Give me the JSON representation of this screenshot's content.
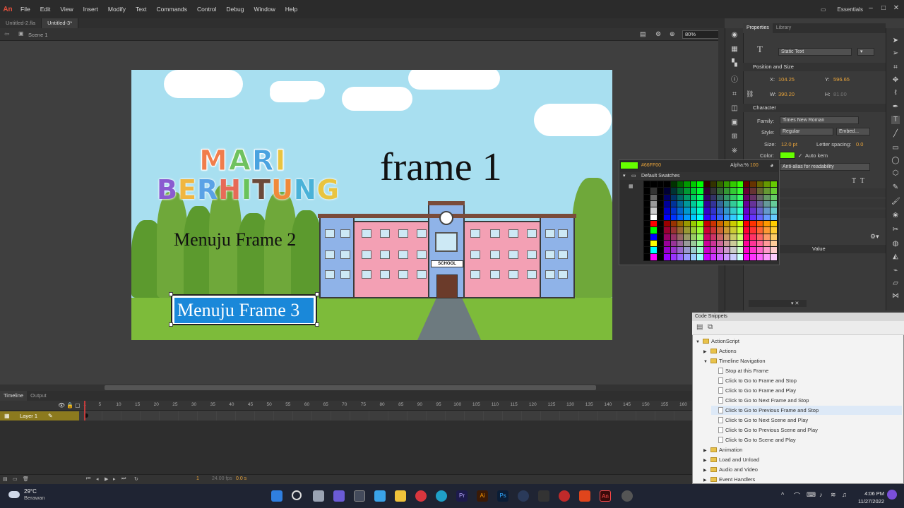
{
  "app": {
    "logo": "An"
  },
  "menu": [
    "File",
    "Edit",
    "View",
    "Insert",
    "Modify",
    "Text",
    "Commands",
    "Control",
    "Debug",
    "Window",
    "Help"
  ],
  "workspace": {
    "label": "Essentials"
  },
  "doc_tabs": [
    "Untitled-2.fla",
    "Untitled-3*"
  ],
  "scene": {
    "label": "Scene 1",
    "zoom": "80%"
  },
  "stage": {
    "title_line1": "MARI",
    "title_line2": "BERHITUNG",
    "frame_text": "frame 1",
    "link2": "Menuju Frame 2",
    "link3": "Menuju Frame 3",
    "school_sign": "SCHOOL",
    "colors": {
      "sky": "#a8dff0",
      "grass": "#7dbb3a",
      "building": "#f3a0b4",
      "wing": "#8fb3e8",
      "selection": "#1a88d9"
    }
  },
  "timeline": {
    "tabs": [
      "Timeline",
      "Output"
    ],
    "ticks": [
      "1",
      "5",
      "10",
      "15",
      "20",
      "25",
      "30",
      "35",
      "40",
      "45",
      "50",
      "55",
      "60",
      "65",
      "70",
      "75",
      "80",
      "85",
      "90",
      "95",
      "100",
      "105",
      "110",
      "115",
      "120",
      "125",
      "130",
      "135",
      "140",
      "145",
      "150",
      "155",
      "160"
    ],
    "layer_name": "Layer 1",
    "current_frame": "1",
    "fps": "24.00 fps",
    "time": "0.0 s"
  },
  "properties": {
    "tabs": [
      "Properties",
      "Library"
    ],
    "text_type": "Static Text",
    "position_section": "Position and Size",
    "x_label": "X:",
    "x": "104.25",
    "y_label": "Y:",
    "y": "596.65",
    "w_label": "W:",
    "w": "390.20",
    "h_label": "H:",
    "h": "81.00",
    "character_section": "Character",
    "family_label": "Family:",
    "family": "Times New Roman",
    "style_label": "Style:",
    "style": "Regular",
    "embed": "Embed...",
    "size_label": "Size:",
    "size": "12.0 pt",
    "spacing_label": "Letter spacing:",
    "spacing": "0.0",
    "color_label": "Color:",
    "text_color": "#66ff00",
    "autokern": "Auto kern",
    "antialias": "Anti-alias for readability",
    "value_header": "Value"
  },
  "swatches": {
    "hex": "#66FF00",
    "alpha_label": "Alpha:%",
    "alpha": "100",
    "title": "Default Swatches"
  },
  "code_snippets": {
    "title": "Code Snippets",
    "items": [
      {
        "label": "ActionScript",
        "kind": "folder",
        "indent": 0,
        "open": true
      },
      {
        "label": "Actions",
        "kind": "folder",
        "indent": 1
      },
      {
        "label": "Timeline Navigation",
        "kind": "folder",
        "indent": 1,
        "open": true
      },
      {
        "label": "Stop at this Frame",
        "kind": "file",
        "indent": 2
      },
      {
        "label": "Click to Go to Frame and Stop",
        "kind": "file",
        "indent": 2
      },
      {
        "label": "Click to Go to Frame and Play",
        "kind": "file",
        "indent": 2
      },
      {
        "label": "Click to Go to Next Frame and Stop",
        "kind": "file",
        "indent": 2
      },
      {
        "label": "Click to Go to Previous Frame and Stop",
        "kind": "file",
        "indent": 2,
        "selected": true
      },
      {
        "label": "Click to Go to Next Scene and Play",
        "kind": "file",
        "indent": 2
      },
      {
        "label": "Click to Go to Previous Scene and Play",
        "kind": "file",
        "indent": 2
      },
      {
        "label": "Click to Go to Scene and Play",
        "kind": "file",
        "indent": 2
      },
      {
        "label": "Animation",
        "kind": "folder",
        "indent": 1
      },
      {
        "label": "Load and Unload",
        "kind": "folder",
        "indent": 1
      },
      {
        "label": "Audio and Video",
        "kind": "folder",
        "indent": 1
      },
      {
        "label": "Event Handlers",
        "kind": "folder",
        "indent": 1
      }
    ]
  },
  "taskbar": {
    "temp": "29°C",
    "weather": "Berawan",
    "time": "4:06 PM",
    "date": "11/27/2022"
  }
}
